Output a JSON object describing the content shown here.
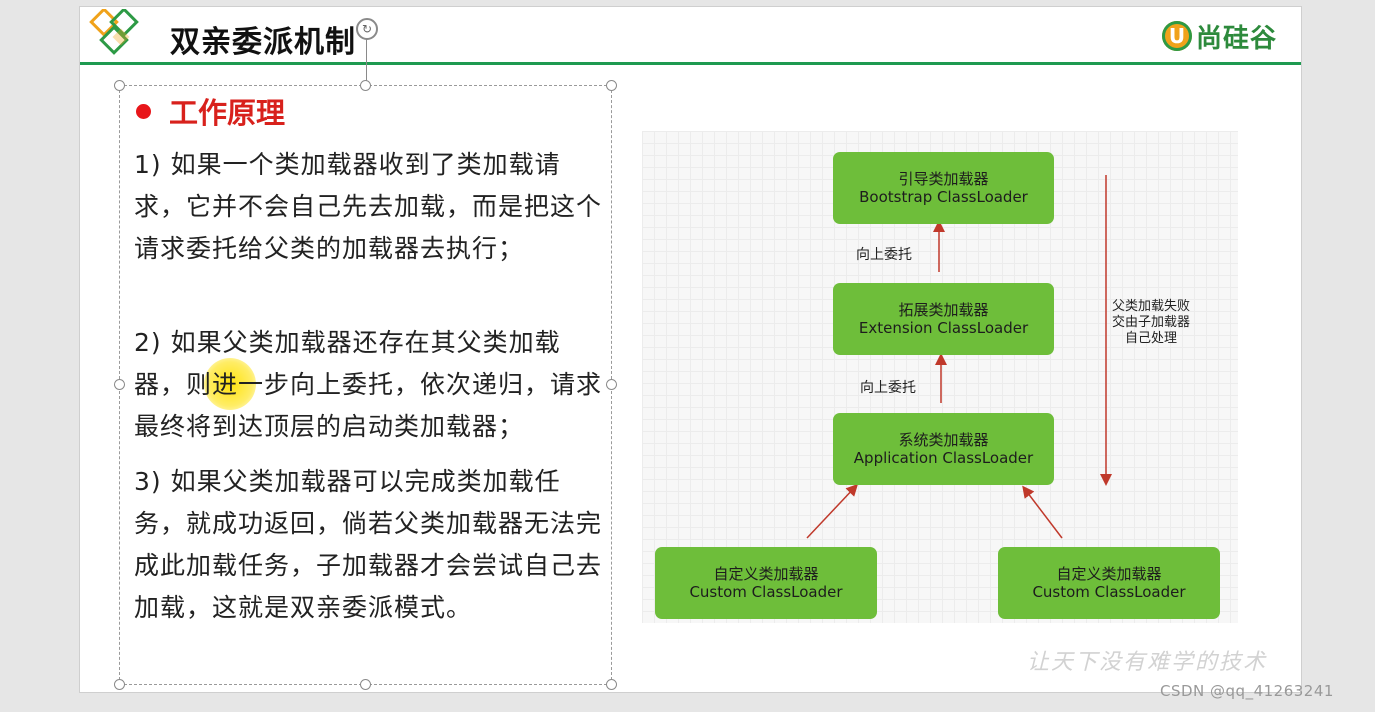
{
  "slide": {
    "title": "双亲委派机制",
    "brand": "尚硅谷",
    "brand_mark": "U",
    "watermark": "让天下没有难学的技术"
  },
  "content": {
    "heading": "工作原理",
    "paragraphs": [
      "1) 如果一个类加载器收到了类加载请求，它并不会自己先去加载，而是把这个请求委托给父类的加载器去执行；",
      "2) 如果父类加载器还存在其父类加载器，则进一步向上委托，依次递归，请求最终将到达顶层的启动类加载器；",
      "3) 如果父类加载器可以完成类加载任务，就成功返回，倘若父类加载器无法完成此加载任务，子加载器才会尝试自己去加载，这就是双亲委派模式。"
    ]
  },
  "diagram": {
    "nodes": {
      "bootstrap": {
        "cn": "引导类加载器",
        "en": "Bootstrap ClassLoader"
      },
      "extension": {
        "cn": "拓展类加载器",
        "en": "Extension ClassLoader"
      },
      "application": {
        "cn": "系统类加载器",
        "en": "Application ClassLoader"
      },
      "custom_left": {
        "cn": "自定义类加载器",
        "en": "Custom ClassLoader"
      },
      "custom_right": {
        "cn": "自定义类加载器",
        "en": "Custom ClassLoader"
      }
    },
    "edge_labels": {
      "upper": "向上委托",
      "lower": "向上委托"
    },
    "side_note": [
      "父类加载失败",
      "交由子加载器",
      "自己处理"
    ],
    "colors": {
      "node": "#6ebe3a",
      "arrow": "#c0392b"
    }
  },
  "footer": {
    "csdn": "CSDN @qq_41263241"
  },
  "colors": {
    "accent": "#1e9a50",
    "heading": "#d8211c",
    "bullet": "#e8161a"
  }
}
